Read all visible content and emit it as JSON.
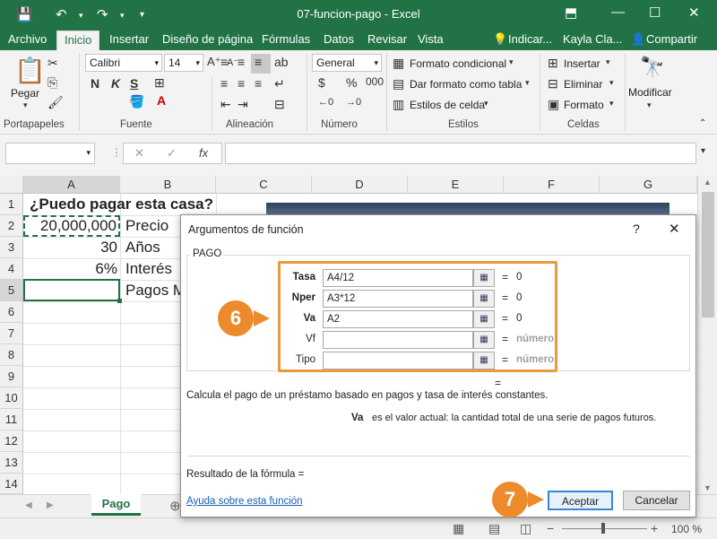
{
  "window": {
    "title": "07-funcion-pago  -  Excel",
    "user": "Kayla Cla...",
    "share": "Compartir",
    "tell_me": "Indicar..."
  },
  "ribbon_tabs": [
    "Archivo",
    "Inicio",
    "Insertar",
    "Diseño de página",
    "Fórmulas",
    "Datos",
    "Revisar",
    "Vista"
  ],
  "ribbon": {
    "paste": "Pegar",
    "font_name": "Calibri",
    "font_size": "14",
    "bold": "N",
    "italic": "K",
    "underline": "S",
    "number_format": "General",
    "cond_format": "Formato condicional",
    "table_format": "Dar formato como tabla",
    "cell_styles": "Estilos de celda",
    "insert": "Insertar",
    "delete": "Eliminar",
    "format": "Formato",
    "modify": "Modificar",
    "groups": [
      "Portapapeles",
      "Fuente",
      "Alineación",
      "Número",
      "Estilos",
      "Celdas"
    ]
  },
  "formula_bar": {
    "fx": "fx"
  },
  "columns": [
    "A",
    "B",
    "C",
    "D",
    "E",
    "F",
    "G"
  ],
  "rows": [
    "1",
    "2",
    "3",
    "4",
    "5",
    "6",
    "7",
    "8",
    "9",
    "10",
    "11",
    "12",
    "13",
    "14"
  ],
  "cells": {
    "a1": "¿Puedo pagar esta casa?",
    "a2": "20,000,000",
    "b2": "Precio",
    "a3": "30",
    "b3": "Años",
    "a4": "6%",
    "b4": "Interés",
    "b5": "Pagos M"
  },
  "sheet_tab": "Pago",
  "dialog": {
    "title": "Argumentos de función",
    "help": "?",
    "function": "PAGO",
    "args": [
      {
        "label": "Tasa",
        "value": "A4/12",
        "result": "0"
      },
      {
        "label": "Nper",
        "value": "A3*12",
        "result": "0"
      },
      {
        "label": "Va",
        "value": "A2",
        "result": "0"
      },
      {
        "label": "Vf",
        "value": "",
        "result": "número"
      },
      {
        "label": "Tipo",
        "value": "",
        "result": "número"
      }
    ],
    "eq_result": "=",
    "description": "Calcula el pago de un préstamo basado en pagos y tasa de interés constantes.",
    "arg_name": "Va",
    "arg_desc": "es el valor actual: la cantidad total de una serie de pagos futuros.",
    "formula_result": "Resultado de la fórmula =",
    "help_link": "Ayuda sobre esta función",
    "ok": "Aceptar",
    "cancel": "Cancelar"
  },
  "callouts": {
    "six": "6",
    "seven": "7"
  },
  "status": {
    "zoom": "100 %"
  },
  "colors": {
    "accent": "#217346",
    "callout": "#ec8a2c"
  }
}
